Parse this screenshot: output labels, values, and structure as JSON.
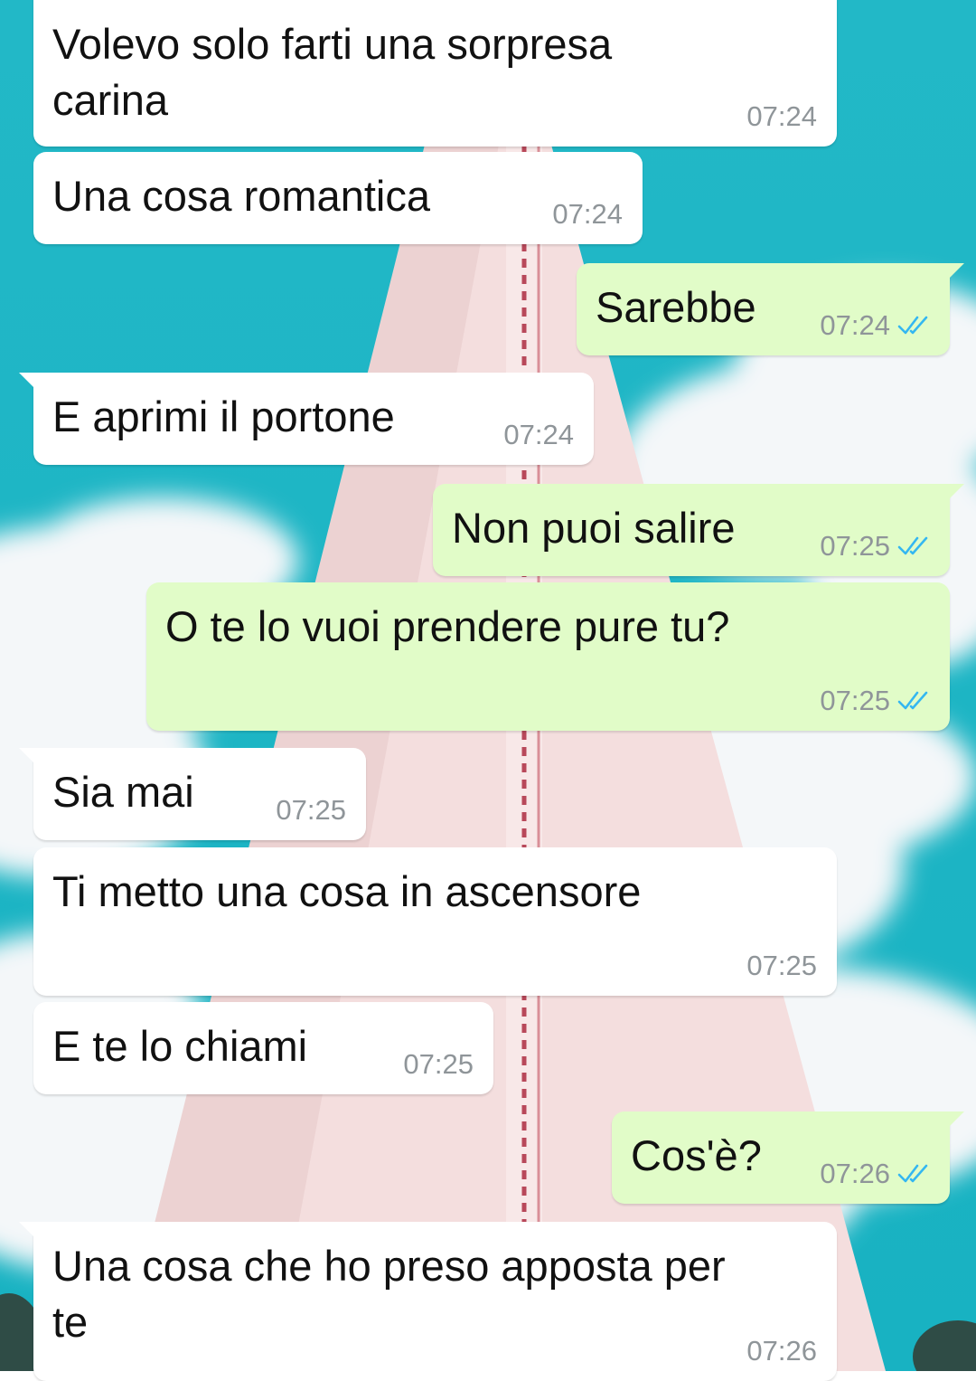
{
  "colors": {
    "incoming_bubble": "#ffffff",
    "outgoing_bubble": "#e1fcc8",
    "read_ticks": "#34b7f1",
    "timestamp": "#8f9599",
    "wallpaper_sky": "#1fb9c9"
  },
  "icons": {
    "read_receipt": "double-check-icon"
  },
  "messages": [
    {
      "direction": "in",
      "text": "Volevo solo farti una sorpresa\ncarina",
      "time": "07:24"
    },
    {
      "direction": "in",
      "text": "Una cosa romantica",
      "time": "07:24"
    },
    {
      "direction": "out",
      "text": "Sarebbe",
      "time": "07:24",
      "status": "read"
    },
    {
      "direction": "in",
      "text": "E aprimi il portone",
      "time": "07:24"
    },
    {
      "direction": "out",
      "text": "Non puoi salire",
      "time": "07:25",
      "status": "read"
    },
    {
      "direction": "out",
      "text": "O te lo vuoi prendere pure tu?",
      "time": "07:25",
      "status": "read"
    },
    {
      "direction": "in",
      "text": "Sia mai",
      "time": "07:25"
    },
    {
      "direction": "in",
      "text": "Ti metto una cosa in ascensore",
      "time": "07:25"
    },
    {
      "direction": "in",
      "text": "E te lo chiami",
      "time": "07:25"
    },
    {
      "direction": "out",
      "text": "Cos'è?",
      "time": "07:26",
      "status": "read"
    },
    {
      "direction": "in",
      "text": "Una cosa che ho preso apposta per\nte",
      "time": "07:26"
    }
  ]
}
